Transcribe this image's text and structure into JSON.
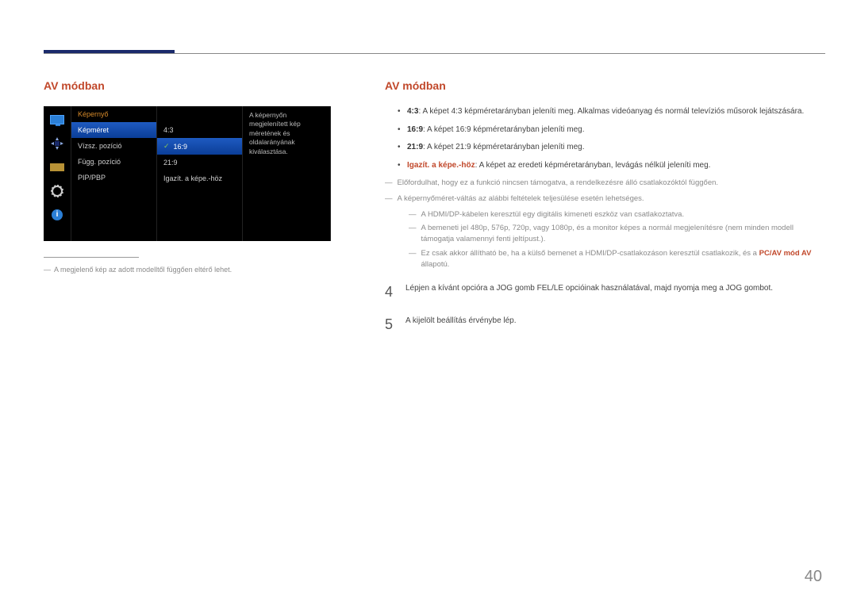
{
  "header": {
    "title_left": "AV módban",
    "title_right": "AV módban"
  },
  "osd": {
    "category_label": "Képernyő",
    "menu_items": [
      "Képméret",
      "Vízsz. pozíció",
      "Függ. pozíció",
      "PIP/PBP"
    ],
    "menu_selected_index": 0,
    "options": [
      "4:3",
      "16:9",
      "21:9",
      "Igazít. a képe.-höz"
    ],
    "option_selected_index": 1,
    "description": "A képernyőn megjelenített kép méretének és oldalarányának kiválasztása."
  },
  "left_footnote": "A megjelenő kép az adott modelltől függően eltérő lehet.",
  "bullets": [
    {
      "label": "4:3",
      "text": ": A képet 4:3 képméretarányban jeleníti meg. Alkalmas videóanyag és normál televíziós műsorok lejátszására."
    },
    {
      "label": "16:9",
      "text": ": A képet 16:9 képméretarányban jeleníti meg."
    },
    {
      "label": "21:9",
      "text": ": A képet 21:9 képméretarányban jeleníti meg."
    },
    {
      "label_accent": "Igazít. a képe.-höz",
      "text": ": A képet az eredeti képméretarányban, levágás nélkül jeleníti meg."
    }
  ],
  "notes": {
    "n1": "Előfordulhat, hogy ez a funkció nincsen támogatva, a rendelkezésre álló csatlakozóktól függően.",
    "n2": "A képernyőméret-váltás az alábbi feltételek teljesülése esetén lehetséges.",
    "sub": [
      "A HDMI/DP-kábelen keresztül egy digitális kimeneti eszköz van csatlakoztatva.",
      "A bemeneti jel 480p, 576p, 720p, vagy 1080p, és a monitor képes a normál megjelenítésre (nem minden modell támogatja valamennyi fenti jeltípust.).",
      {
        "pre": "Ez csak akkor állítható be, ha a külső bemenet a HDMI/DP-csatlakozáson keresztül csatlakozik, és a ",
        "accent": "PC/AV mód AV",
        "post": " állapotú."
      }
    ]
  },
  "steps": [
    {
      "num": "4",
      "text": "Lépjen a kívánt opcióra a JOG gomb FEL/LE opcióinak használatával, majd nyomja meg a JOG gombot."
    },
    {
      "num": "5",
      "text": "A kijelölt beállítás érvénybe lép."
    }
  ],
  "page_number": "40"
}
